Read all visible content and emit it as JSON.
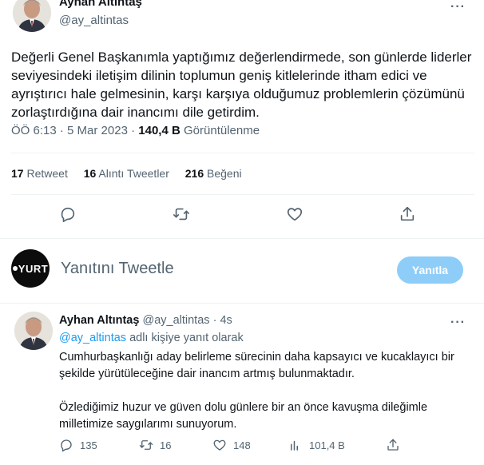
{
  "main_tweet": {
    "author_name": "Ayhan Altıntaş",
    "author_handle": "@ay_altintas",
    "text": "Değerli Genel Başkanımla yaptığımız değerlendirmede, son günlerde liderler seviyesindeki iletişim dilinin toplumun geniş kitlelerinde itham edici ve ayrıştırıcı hale gelmesinin, karşı karşıya olduğumuz problemlerin çözümünü zorlaştırdığına dair inancımı dile getirdim.",
    "time": "ÖÖ 6:13",
    "separator": "·",
    "date": "5 Mar 2023",
    "views_count": "140,4 B",
    "views_label": "Görüntülenme",
    "stats": {
      "retweets_count": "17",
      "retweets_label": "Retweet",
      "quotes_count": "16",
      "quotes_label": "Alıntı Tweetler",
      "likes_count": "216",
      "likes_label": "Beğeni"
    }
  },
  "reply_composer": {
    "avatar_text": "YURT",
    "placeholder": "Yanıtını Tweetle",
    "button_label": "Yanıtla"
  },
  "reply_tweet": {
    "author_name": "Ayhan Altıntaş",
    "author_handle": "@ay_altintas",
    "separator": "·",
    "time": "4s",
    "replying_mention": "@ay_altintas",
    "replying_suffix": "adlı kişiye yanıt olarak",
    "paragraph_1": "Cumhurbaşkanlığı aday belirleme sürecinin daha kapsayıcı ve kucaklayıcı bir şekilde yürütüleceğine dair inancım artmış bulunmaktadır.",
    "paragraph_2": "Özlediğimiz huzur ve güven dolu günlere bir an önce kavuşma  dileğimle milletimize saygılarımı sunuyorum.",
    "actions": {
      "replies": "135",
      "retweets": "16",
      "likes": "148",
      "views": "101,4 B"
    }
  },
  "icons": {
    "more": "more-horizontal-icon",
    "reply": "reply-bubble-icon",
    "retweet": "retweet-icon",
    "like": "heart-icon",
    "share": "share-icon",
    "views": "bar-chart-icon"
  },
  "colors": {
    "accent": "#1d9bf0",
    "button_disabled": "#8ecdf8",
    "secondary_text": "#536471",
    "primary_text": "#0f1419",
    "divider": "#eff3f4"
  }
}
